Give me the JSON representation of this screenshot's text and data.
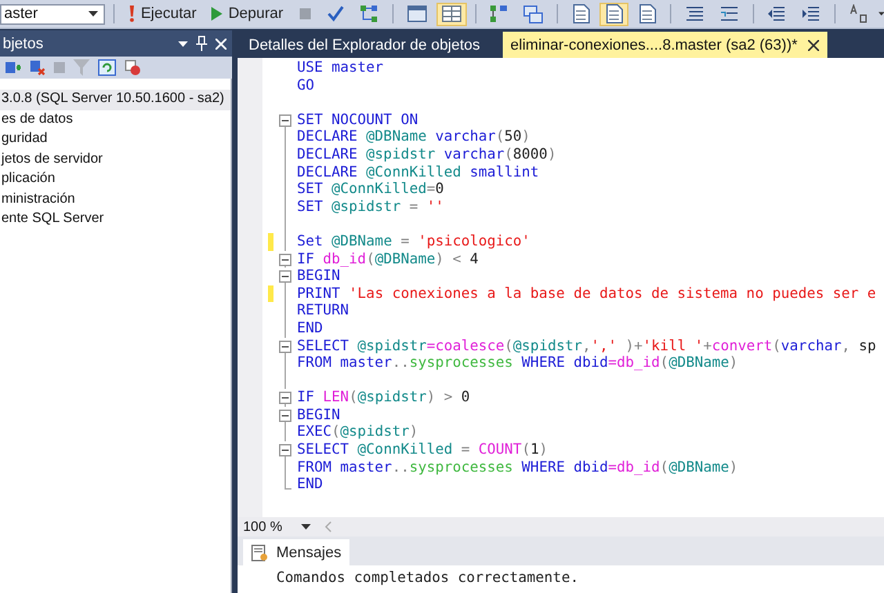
{
  "toolbar": {
    "database": "aster",
    "execute": "Ejecutar",
    "debug": "Depurar",
    "buttons": [
      {
        "kind": "stop",
        "pressed": false
      },
      {
        "kind": "check",
        "pressed": false
      },
      {
        "kind": "tree",
        "pressed": false
      },
      {
        "kind": "window",
        "pressed": false
      },
      {
        "kind": "grid",
        "pressed": true
      },
      {
        "kind": "diagram",
        "pressed": false
      },
      {
        "kind": "windows",
        "pressed": false
      },
      {
        "kind": "doc",
        "pressed": false
      },
      {
        "kind": "doc",
        "pressed": true
      },
      {
        "kind": "doc",
        "pressed": false
      },
      {
        "kind": "lines",
        "pressed": false
      },
      {
        "kind": "comment",
        "pressed": false
      },
      {
        "kind": "outdent",
        "pressed": false
      },
      {
        "kind": "indent",
        "pressed": false
      },
      {
        "kind": "abc",
        "pressed": false
      }
    ]
  },
  "object_explorer": {
    "title": "bjetos",
    "items": [
      {
        "label": "3.0.8 (SQL Server 10.50.1600 - sa2)",
        "selected": true
      },
      {
        "label": "es de datos",
        "selected": false
      },
      {
        "label": "guridad",
        "selected": false
      },
      {
        "label": "jetos de servidor",
        "selected": false
      },
      {
        "label": "plicación",
        "selected": false
      },
      {
        "label": "ministración",
        "selected": false
      },
      {
        "label": "ente SQL Server",
        "selected": false
      }
    ]
  },
  "tabs": [
    {
      "label": "Detalles del Explorador de objetos",
      "selected": false
    },
    {
      "label": "eliminar-conexiones....8.master (sa2 (63))*",
      "selected": true
    }
  ],
  "code": {
    "lines": [
      {
        "kind": "plain",
        "changed": false,
        "tokens": [
          {
            "kind": "kw",
            "text": "USE master"
          }
        ]
      },
      {
        "kind": "plain",
        "changed": false,
        "tokens": [
          {
            "kind": "kw",
            "text": "GO"
          }
        ]
      },
      {
        "kind": "plain",
        "changed": false
      },
      {
        "kind": "fold-start",
        "changed": false,
        "tokens": [
          {
            "kind": "kw",
            "text": "SET NOCOUNT ON"
          }
        ]
      },
      {
        "kind": "fold-inner",
        "changed": false,
        "tokens": [
          {
            "kind": "kw",
            "text": "DECLARE "
          },
          {
            "kind": "var",
            "text": "@DBName"
          },
          {
            "kind": "kw",
            "text": " varchar"
          },
          {
            "kind": "op",
            "text": "("
          },
          {
            "kind": "num",
            "text": "50"
          },
          {
            "kind": "op",
            "text": ")"
          }
        ]
      },
      {
        "kind": "fold-inner",
        "changed": false,
        "tokens": [
          {
            "kind": "kw",
            "text": "DECLARE "
          },
          {
            "kind": "var",
            "text": "@spidstr"
          },
          {
            "kind": "kw",
            "text": " varchar"
          },
          {
            "kind": "op",
            "text": "("
          },
          {
            "kind": "num",
            "text": "8000"
          },
          {
            "kind": "op",
            "text": ")"
          }
        ]
      },
      {
        "kind": "fold-inner",
        "changed": false,
        "tokens": [
          {
            "kind": "kw",
            "text": "DECLARE "
          },
          {
            "kind": "var",
            "text": "@ConnKilled"
          },
          {
            "kind": "kw",
            "text": " smallint"
          }
        ]
      },
      {
        "kind": "fold-inner",
        "changed": false,
        "tokens": [
          {
            "kind": "kw",
            "text": "SET "
          },
          {
            "kind": "var",
            "text": "@ConnKilled"
          },
          {
            "kind": "op",
            "text": "="
          },
          {
            "kind": "num",
            "text": "0"
          }
        ]
      },
      {
        "kind": "fold-inner",
        "changed": false,
        "tokens": [
          {
            "kind": "kw",
            "text": "SET "
          },
          {
            "kind": "var",
            "text": "@spidstr"
          },
          {
            "kind": "op",
            "text": " = "
          },
          {
            "kind": "str",
            "text": "''"
          }
        ]
      },
      {
        "kind": "fold-inner",
        "changed": false
      },
      {
        "kind": "fold-inner",
        "changed": true,
        "tokens": [
          {
            "kind": "kw",
            "text": "Set "
          },
          {
            "kind": "var",
            "text": "@DBName"
          },
          {
            "kind": "op",
            "text": " = "
          },
          {
            "kind": "str",
            "text": "'psicologico'"
          }
        ]
      },
      {
        "kind": "fold-start",
        "changed": false,
        "tokens": [
          {
            "kind": "kw",
            "text": "IF "
          },
          {
            "kind": "fn",
            "text": "db_id"
          },
          {
            "kind": "op",
            "text": "("
          },
          {
            "kind": "var",
            "text": "@DBName"
          },
          {
            "kind": "op",
            "text": ") < "
          },
          {
            "kind": "num",
            "text": "4"
          }
        ]
      },
      {
        "kind": "fold-start",
        "changed": false,
        "tokens": [
          {
            "kind": "kw",
            "text": "BEGIN"
          }
        ]
      },
      {
        "kind": "fold-inner",
        "changed": true,
        "tokens": [
          {
            "kind": "kw",
            "text": "PRINT "
          },
          {
            "kind": "str",
            "text": "'Las conexiones a la base de datos de sistema no puedes ser e"
          }
        ]
      },
      {
        "kind": "fold-inner",
        "changed": false,
        "tokens": [
          {
            "kind": "kw",
            "text": "RETURN"
          }
        ]
      },
      {
        "kind": "fold-inner",
        "changed": false,
        "tokens": [
          {
            "kind": "kw",
            "text": "END"
          }
        ]
      },
      {
        "kind": "fold-start",
        "changed": false,
        "tokens": [
          {
            "kind": "kw",
            "text": "SELECT "
          },
          {
            "kind": "var",
            "text": "@spidstr"
          },
          {
            "kind": "fn",
            "text": "=coalesce"
          },
          {
            "kind": "op",
            "text": "("
          },
          {
            "kind": "var",
            "text": "@spidstr"
          },
          {
            "kind": "op",
            "text": ","
          },
          {
            "kind": "str",
            "text": "','"
          },
          {
            "kind": "op",
            "text": " )+"
          },
          {
            "kind": "str",
            "text": "'kill '"
          },
          {
            "kind": "op",
            "text": "+"
          },
          {
            "kind": "fn",
            "text": "convert"
          },
          {
            "kind": "op",
            "text": "("
          },
          {
            "kind": "kw",
            "text": "varchar"
          },
          {
            "kind": "op",
            "text": ", "
          },
          {
            "kind": "plain",
            "text": "sp"
          }
        ]
      },
      {
        "kind": "fold-inner",
        "changed": false,
        "tokens": [
          {
            "kind": "kw",
            "text": "FROM master"
          },
          {
            "kind": "op",
            "text": ".."
          },
          {
            "kind": "sys",
            "text": "sysprocesses"
          },
          {
            "kind": "kw",
            "text": " WHERE dbid"
          },
          {
            "kind": "fn",
            "text": "=db_id"
          },
          {
            "kind": "op",
            "text": "("
          },
          {
            "kind": "var",
            "text": "@DBName"
          },
          {
            "kind": "op",
            "text": ")"
          }
        ]
      },
      {
        "kind": "fold-inner",
        "changed": false
      },
      {
        "kind": "fold-start",
        "changed": false,
        "tokens": [
          {
            "kind": "kw",
            "text": "IF "
          },
          {
            "kind": "fn",
            "text": "LEN"
          },
          {
            "kind": "op",
            "text": "("
          },
          {
            "kind": "var",
            "text": "@spidstr"
          },
          {
            "kind": "op",
            "text": ") > "
          },
          {
            "kind": "num",
            "text": "0"
          }
        ]
      },
      {
        "kind": "fold-start",
        "changed": false,
        "tokens": [
          {
            "kind": "kw",
            "text": "BEGIN"
          }
        ]
      },
      {
        "kind": "fold-inner",
        "changed": false,
        "tokens": [
          {
            "kind": "kw",
            "text": "EXEC"
          },
          {
            "kind": "op",
            "text": "("
          },
          {
            "kind": "var",
            "text": "@spidstr"
          },
          {
            "kind": "op",
            "text": ")"
          }
        ]
      },
      {
        "kind": "fold-start",
        "changed": false,
        "tokens": [
          {
            "kind": "kw",
            "text": "SELECT "
          },
          {
            "kind": "var",
            "text": "@ConnKilled"
          },
          {
            "kind": "op",
            "text": " = "
          },
          {
            "kind": "fn",
            "text": "COUNT"
          },
          {
            "kind": "op",
            "text": "("
          },
          {
            "kind": "num",
            "text": "1"
          },
          {
            "kind": "op",
            "text": ")"
          }
        ]
      },
      {
        "kind": "fold-inner",
        "changed": false,
        "tokens": [
          {
            "kind": "kw",
            "text": "FROM master"
          },
          {
            "kind": "op",
            "text": ".."
          },
          {
            "kind": "sys",
            "text": "sysprocesses"
          },
          {
            "kind": "kw",
            "text": " WHERE dbid"
          },
          {
            "kind": "fn",
            "text": "=db_id"
          },
          {
            "kind": "op",
            "text": "("
          },
          {
            "kind": "var",
            "text": "@DBName"
          },
          {
            "kind": "op",
            "text": ")"
          }
        ]
      },
      {
        "kind": "fold-end",
        "changed": false,
        "tokens": [
          {
            "kind": "kw",
            "text": "END"
          }
        ]
      }
    ]
  },
  "zoom": "100 %",
  "results": {
    "tabs": [
      {
        "label": "Mensajes",
        "selected": true
      }
    ],
    "message": "Comandos completados correctamente."
  }
}
